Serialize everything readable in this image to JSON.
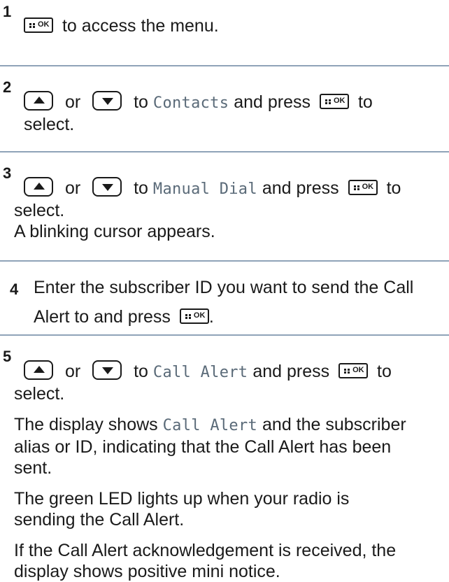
{
  "steps": [
    {
      "number": "1",
      "text": "to access the menu."
    },
    {
      "number": "2",
      "or": "or",
      "to": "to",
      "item": "Contacts",
      "and_press": "and press",
      "to_end": "to",
      "select": "select."
    },
    {
      "number": "3",
      "or": "or",
      "to": "to",
      "item": "Manual Dial",
      "and_press": "and press",
      "to_end": "to",
      "select": "select.",
      "result": "A blinking cursor appears."
    },
    {
      "number": "4",
      "line1": "Enter the subscriber ID you want to send the Call",
      "line2": "Alert to and press",
      "period": "."
    },
    {
      "number": "5",
      "or": "or",
      "to": "to",
      "item": "Call Alert",
      "and_press": "and press",
      "to_end": "to",
      "select": "select.",
      "display_pre": "The display shows",
      "display_item": "Call Alert",
      "display_post": "and the subscriber alias or ID, indicating that the Call Alert has been sent.",
      "led": "The green LED lights up when your radio is sending the Call Alert.",
      "ack": "If the Call Alert acknowledgement is received, the display shows positive mini notice."
    }
  ],
  "icons": {
    "ok_button": "menu-ok-button-icon",
    "up_button": "up-arrow-button-icon",
    "down_button": "down-arrow-button-icon",
    "ok_label": "OK"
  },
  "colors": {
    "separator": "#8fa3b8",
    "menu_text": "#5a6a78"
  }
}
